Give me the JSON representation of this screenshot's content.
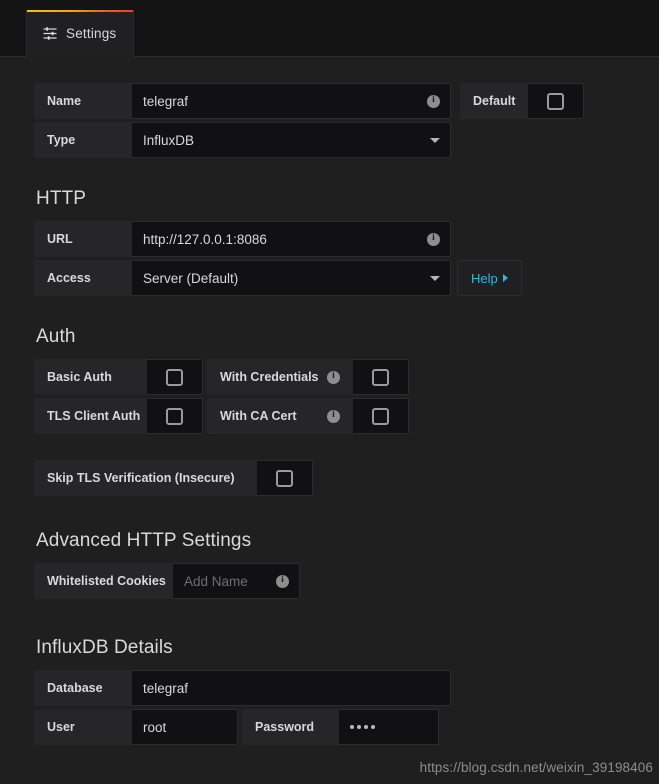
{
  "tab": {
    "label": "Settings",
    "icon": "sliders-icon",
    "accent_gradient_from": "#f2c200",
    "accent_gradient_to": "#eb3d28"
  },
  "colors": {
    "page_bg": "#1f1f20",
    "label_bg": "#262628",
    "input_bg": "#111113",
    "border": "#2c2c2e",
    "text": "#d8d9da",
    "link": "#33b5e5",
    "placeholder": "#6e6e6e"
  },
  "general": {
    "name": {
      "label": "Name",
      "value": "telegraf",
      "info_icon": "info-icon"
    },
    "default": {
      "label": "Default",
      "checked": false
    },
    "type": {
      "label": "Type",
      "value": "InfluxDB",
      "caret_icon": "chevron-down-icon"
    }
  },
  "http": {
    "title": "HTTP",
    "url": {
      "label": "URL",
      "value": "http://127.0.0.1:8086",
      "info_icon": "info-icon"
    },
    "access": {
      "label": "Access",
      "value": "Server (Default)",
      "caret_icon": "chevron-down-icon"
    },
    "help": {
      "label": "Help",
      "caret_icon": "caret-right-icon"
    }
  },
  "auth": {
    "title": "Auth",
    "items": [
      {
        "label": "Basic Auth",
        "checked": false,
        "info": false
      },
      {
        "label": "With Credentials",
        "checked": false,
        "info": true
      },
      {
        "label": "TLS Client Auth",
        "checked": false,
        "info": false
      },
      {
        "label": "With CA Cert",
        "checked": false,
        "info": true
      }
    ],
    "skip_tls": {
      "label": "Skip TLS Verification (Insecure)",
      "checked": false
    }
  },
  "advanced": {
    "title": "Advanced HTTP Settings",
    "cookies": {
      "label": "Whitelisted Cookies",
      "value": "",
      "placeholder": "Add Name",
      "info_icon": "info-icon"
    }
  },
  "influxdb": {
    "title": "InfluxDB Details",
    "database": {
      "label": "Database",
      "value": "telegraf"
    },
    "user": {
      "label": "User",
      "value": "root"
    },
    "password": {
      "label": "Password",
      "value": "••••",
      "dots": 4
    }
  },
  "watermark": "https://blog.csdn.net/weixin_39198406"
}
